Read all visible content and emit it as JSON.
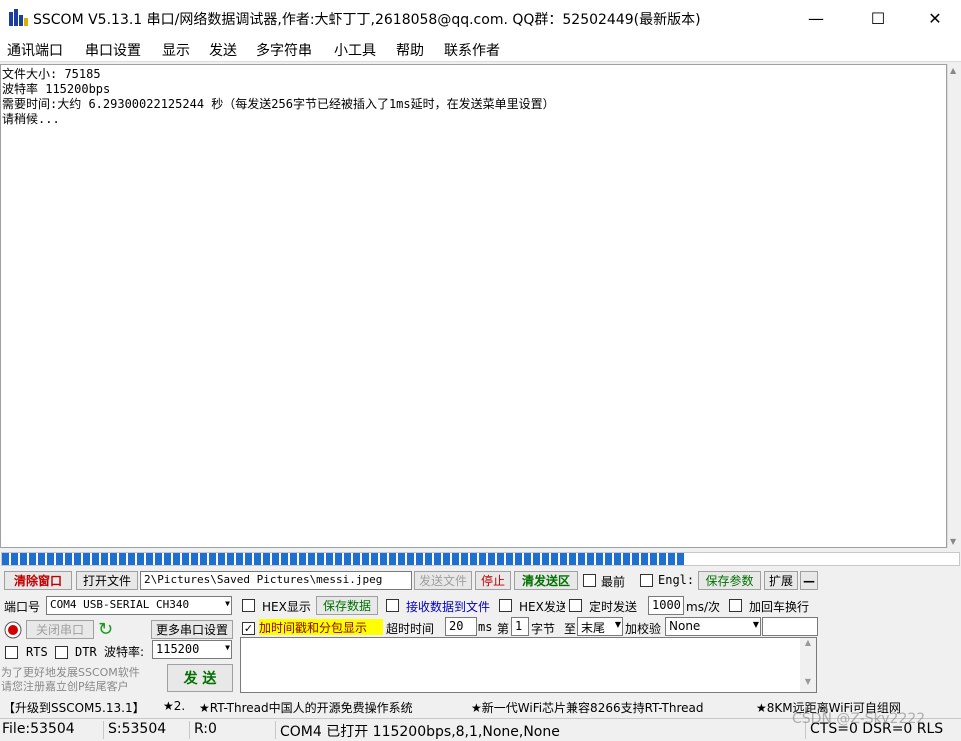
{
  "window": {
    "title": "SSCOM V5.13.1 串口/网络数据调试器,作者:大虾丁丁,2618058@qq.com. QQ群：52502449(最新版本)",
    "minimize": "—",
    "maximize": "☐",
    "close": "✕"
  },
  "menu": [
    "通讯端口",
    "串口设置",
    "显示",
    "发送",
    "多字符串",
    "小工具",
    "帮助",
    "联系作者"
  ],
  "rx_lines": [
    "文件大小: 75185",
    "波特率 115200bps",
    "需要时间:大约 6.29300022125244 秒（每发送256字节已经被插入了1ms延时，在发送菜单里设置）",
    "请稍候..."
  ],
  "progress": 0.715,
  "toolbar": {
    "clear": "清除窗口",
    "open_file": "打开文件",
    "file_path": "2\\Pictures\\Saved Pictures\\messi.jpeg",
    "send_file": "发送文件",
    "stop": "停止",
    "clear_send": "清发送区",
    "last": "最前",
    "english": "Engl:",
    "save_params": "保存参数",
    "expand": "扩展",
    "collapse": "—"
  },
  "row1": {
    "port_label": "端口号",
    "port_value": "COM4 USB-SERIAL CH340",
    "hex_display": "HEX显示",
    "save_data": "保存数据",
    "recv_to_file": "接收数据到文件",
    "hex_send": "HEX发送",
    "timed_send": "定时发送",
    "interval": "1000",
    "interval_unit": "ms/次",
    "add_crlf": "加回车换行"
  },
  "row2": {
    "close_port": "关闭串口",
    "more_settings": "更多串口设置",
    "timestamp": "加时间戳和分包显示",
    "timeout_label": "超时时间",
    "timeout_value": "20",
    "timeout_unit": "ms",
    "nth": "第",
    "byte_index": "1",
    "byte_label": "字节",
    "to": "至",
    "end": "末尾",
    "checksum_label": "加校验",
    "checksum_value": "None"
  },
  "row3": {
    "rts": "RTS",
    "dtr": "DTR",
    "baud_label": "波特率:",
    "baud_value": "115200"
  },
  "promo": {
    "line1": "为了更好地发展SSCOM软件",
    "line2": "请您注册嘉立创P结尾客户"
  },
  "send_button": "发  送",
  "ticker": [
    "【升级到SSCOM5.13.1】",
    "★2.",
    "★RT-Thread中国人的开源免费操作系统",
    "★新一代WiFi芯片兼容8266支持RT-Thread",
    "★8KM远距离WiFi可自组网"
  ],
  "status": {
    "file": "File:53504",
    "sent": "S:53504",
    "recv": "R:0",
    "port_info": "COM4 已打开  115200bps,8,1,None,None",
    "lines": "CTS=0 DSR=0 RLS"
  },
  "watermark": "CSDN @Z-Sky2222",
  "colors": {
    "progress": "#1e6fcf",
    "clear_red": "#c00000",
    "save_green": "#007000",
    "blue": "#0000c0",
    "highlight_yellow": "#ffff00"
  }
}
